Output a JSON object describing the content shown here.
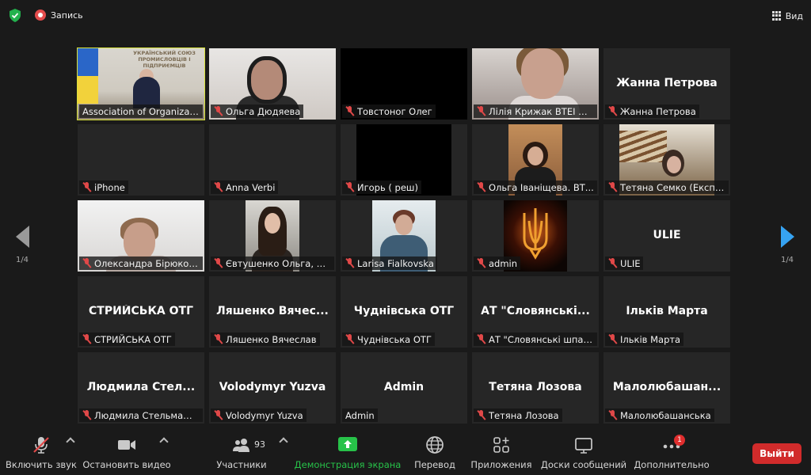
{
  "topbar": {
    "recording_label": "Запись",
    "view_label": "Вид"
  },
  "nav": {
    "left_page": "1/4",
    "right_page": "1/4"
  },
  "usp_sign": "УКРАЇНСЬКИЙ СОЮЗ ПРОМИСЛОВЦІВ І ПІДПРИЄМЦІВ",
  "tiles": [
    {
      "name": "Association of Organizat...",
      "big": ""
    },
    {
      "name": "Ольга Дюдяева",
      "big": ""
    },
    {
      "name": "Товстоног Олег",
      "big": ""
    },
    {
      "name": "Лілія Крижак ВТЕІ ДТ...",
      "big": ""
    },
    {
      "name": "Жанна Петрова",
      "big": "Жанна Петрова"
    },
    {
      "name": "iPhone",
      "big": ""
    },
    {
      "name": "Anna Verbi",
      "big": ""
    },
    {
      "name": "Игорь ( реш)",
      "big": ""
    },
    {
      "name": "Ольга Іваніщева. ВТ...",
      "big": ""
    },
    {
      "name": "Тетяна Семко (Експе...",
      "big": ""
    },
    {
      "name": "Олександра Бірюкова",
      "big": ""
    },
    {
      "name": "Євтушенко Ольга, Х...",
      "big": ""
    },
    {
      "name": "Larisa Fialkovska",
      "big": ""
    },
    {
      "name": "admin",
      "big": ""
    },
    {
      "name": "ULIE",
      "big": "ULIE"
    },
    {
      "name": "СТРИЙСЬКА ОТГ",
      "big": "СТРИЙСЬКА ОТГ"
    },
    {
      "name": "Ляшенко Вячеслав",
      "big": "Ляшенко Вячес..."
    },
    {
      "name": "Чуднівська ОТГ",
      "big": "Чуднівська ОТГ"
    },
    {
      "name": "АТ \"Словянські шпал...",
      "big": "АТ \"Словянські..."
    },
    {
      "name": "Ільків Марта",
      "big": "Ільків Марта"
    },
    {
      "name": "Людмила Стельмащук",
      "big": "Людмила Стел..."
    },
    {
      "name": "Volodymyr Yuzva",
      "big": "Volodymyr Yuzva"
    },
    {
      "name": "Admin",
      "big": "Admin"
    },
    {
      "name": "Тетяна Лозова",
      "big": "Тетяна Лозова"
    },
    {
      "name": "Малолюбашанська",
      "big": "Малолюбашан..."
    }
  ],
  "toolbar": {
    "mute_label": "Включить звук",
    "video_label": "Остановить видео",
    "participants_label": "Участники",
    "participants_count": "93",
    "share_label": "Демонстрация экрана",
    "translate_label": "Перевод",
    "apps_label": "Приложения",
    "whiteboard_label": "Доски сообщений",
    "more_label": "Дополнительно",
    "more_badge": "1",
    "leave_label": "Выйти"
  },
  "colors": {
    "accent": "#36a3f2",
    "active_speaker": "#d8e23a",
    "leave": "#d12b2b",
    "share": "#27c249",
    "muted": "#e04848"
  }
}
